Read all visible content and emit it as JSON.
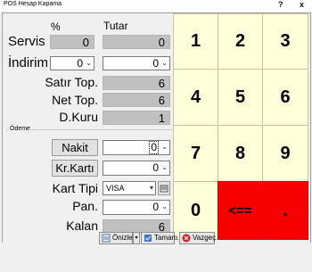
{
  "window": {
    "title": "POS Hesap Kapama",
    "help_label": "?",
    "close_label": "x"
  },
  "header": {
    "percent_label": "%",
    "amount_label": "Tutar"
  },
  "form": {
    "servis": {
      "label": "Servis",
      "percent": "0",
      "amount": "0"
    },
    "indirim": {
      "label": "İndirim",
      "percent": "0",
      "amount": "0"
    },
    "satir_top": {
      "label": "Satır Top.",
      "value": "6"
    },
    "net_top": {
      "label": "Net Top.",
      "value": "6"
    },
    "d_kuru": {
      "label": "D.Kuru",
      "value": "1"
    }
  },
  "payment": {
    "group_label": "Ödeme",
    "nakit": {
      "label": "Nakit",
      "value": "0"
    },
    "kr_karti": {
      "label": "Kr.Kartı",
      "value": "0"
    },
    "kart_tipi": {
      "label": "Kart Tipi",
      "value": "VISA"
    },
    "pan": {
      "label": "Pan.",
      "value": "0"
    },
    "kalan": {
      "label": "Kalan",
      "value": "6"
    }
  },
  "keypad": {
    "keys": [
      "1",
      "2",
      "3",
      "4",
      "5",
      "6",
      "7",
      "8",
      "9",
      "0",
      "<==",
      "."
    ]
  },
  "footer": {
    "preview_label": "Önizle",
    "ok_label": "Tamam",
    "cancel_label": "Vazgeç"
  },
  "colors": {
    "keypad_bg": "#ffffd9",
    "keypad_red": "#f80000",
    "readonly_bg": "#c0c0c0"
  }
}
